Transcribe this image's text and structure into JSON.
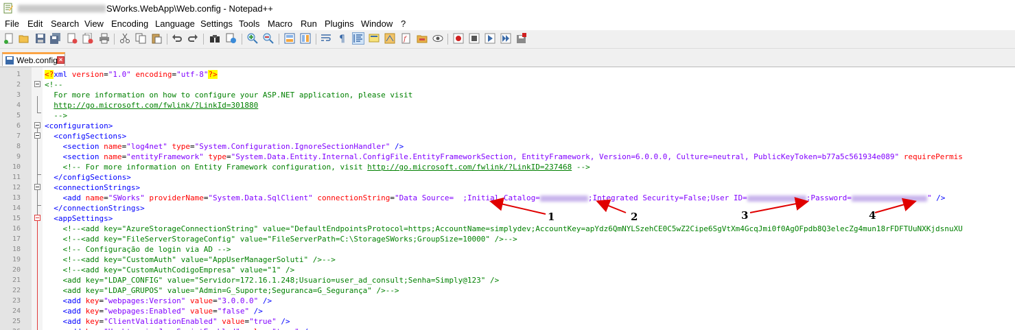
{
  "window": {
    "title_suffix": "SWorks.WebApp\\Web.config - Notepad++"
  },
  "menu": [
    "File",
    "Edit",
    "Search",
    "View",
    "Encoding",
    "Language",
    "Settings",
    "Tools",
    "Macro",
    "Run",
    "Plugins",
    "Window",
    "?"
  ],
  "toolbar_icons": [
    "new-file",
    "open-file",
    "save",
    "save-all",
    "close",
    "close-all",
    "print",
    "cut",
    "copy",
    "paste",
    "undo",
    "redo",
    "find",
    "replace",
    "zoom-in",
    "zoom-out",
    "sync-vertical",
    "sync-horizontal",
    "word-wrap",
    "show-all-chars",
    "indent-guide",
    "user-language",
    "doc-map",
    "function-list",
    "folder-as-workspace",
    "monitoring",
    "record-macro",
    "stop-macro",
    "play-macro",
    "run-macro-multiple",
    "save-macro"
  ],
  "tab": {
    "label": "Web.config"
  },
  "lines": [
    {
      "n": "1",
      "segs": [
        [
          "hl",
          "<?"
        ],
        [
          "k",
          "xml"
        ],
        [
          "a",
          " version"
        ],
        [
          "x",
          "="
        ],
        [
          "v",
          "\"1.0\""
        ],
        [
          "a",
          " encoding"
        ],
        [
          "x",
          "="
        ],
        [
          "v",
          "\"utf-8\""
        ],
        [
          "hl",
          "?>"
        ]
      ]
    },
    {
      "n": "2",
      "segs": [
        [
          "c",
          "<!--"
        ]
      ]
    },
    {
      "n": "3",
      "segs": [
        [
          "c",
          "  For more information on how to configure your ASP.NET application, please visit"
        ]
      ]
    },
    {
      "n": "4",
      "segs": [
        [
          "c",
          "  "
        ],
        [
          "u",
          "http://go.microsoft.com/fwlink/?LinkId=301880"
        ]
      ]
    },
    {
      "n": "5",
      "segs": [
        [
          "c",
          "  -->"
        ]
      ]
    },
    {
      "n": "6",
      "segs": [
        [
          "k",
          "<configuration>"
        ]
      ]
    },
    {
      "n": "7",
      "segs": [
        [
          "k",
          "  <configSections>"
        ]
      ]
    },
    {
      "n": "8",
      "segs": [
        [
          "k",
          "    <section"
        ],
        [
          "a",
          " name"
        ],
        [
          "x",
          "="
        ],
        [
          "v",
          "\"log4net\""
        ],
        [
          "a",
          " type"
        ],
        [
          "x",
          "="
        ],
        [
          "v",
          "\"System.Configuration.IgnoreSectionHandler\""
        ],
        [
          "k",
          " />"
        ]
      ]
    },
    {
      "n": "9",
      "segs": [
        [
          "k",
          "    <section"
        ],
        [
          "a",
          " name"
        ],
        [
          "x",
          "="
        ],
        [
          "v",
          "\"entityFramework\""
        ],
        [
          "a",
          " type"
        ],
        [
          "x",
          "="
        ],
        [
          "v",
          "\"System.Data.Entity.Internal.ConfigFile.EntityFrameworkSection, EntityFramework, Version=6.0.0.0, Culture=neutral, PublicKeyToken=b77a5c561934e089\""
        ],
        [
          "a",
          " requirePermis"
        ]
      ]
    },
    {
      "n": "10",
      "segs": [
        [
          "c",
          "    <!-- For more information on Entity Framework configuration, visit "
        ],
        [
          "u",
          "http://go.microsoft.com/fwlink/?LinkID=237468"
        ],
        [
          "c",
          " -->"
        ]
      ]
    },
    {
      "n": "11",
      "segs": [
        [
          "k",
          "  </configSections>"
        ]
      ]
    },
    {
      "n": "12",
      "segs": [
        [
          "k",
          "  <connectionStrings>"
        ]
      ]
    },
    {
      "n": "13",
      "segs": [
        [
          "k",
          "    <add"
        ],
        [
          "a",
          " name"
        ],
        [
          "x",
          "="
        ],
        [
          "v",
          "\"SWorks\""
        ],
        [
          "a",
          " providerName"
        ],
        [
          "x",
          "="
        ],
        [
          "v",
          "\"System.Data.SqlClient\""
        ],
        [
          "a",
          " connectionString"
        ],
        [
          "x",
          "="
        ],
        [
          "v",
          "\"Data Source=  ;Initial Catalog="
        ],
        [
          "blur",
          "70"
        ],
        [
          "v",
          ";Integrated Security=False;User ID="
        ],
        [
          "blur",
          "86"
        ],
        [
          "v",
          ";Password="
        ],
        [
          "blur",
          "110"
        ],
        [
          "v",
          "\""
        ],
        [
          "k",
          " />"
        ]
      ]
    },
    {
      "n": "14",
      "segs": [
        [
          "k",
          "  </connectionStrings>"
        ]
      ]
    },
    {
      "n": "15",
      "segs": [
        [
          "k",
          "  <appSettings>"
        ]
      ]
    },
    {
      "n": "16",
      "segs": [
        [
          "c",
          "    <!--<add key=\"AzureStorageConnectionString\" value=\"DefaultEndpointsProtocol=https;AccountName=simplydev;AccountKey=apYdz6QmNYLSzehCE0C5wZ2Cipe6SgVtXm4GcqJmi0f0AgOFpdb8Q3elecZg4mun18rFDFTUuNXKjdsnuXU"
        ]
      ]
    },
    {
      "n": "17",
      "segs": [
        [
          "c",
          "    <!--<add key=\"FileServerStorageConfig\" value=\"FileServerPath=C:\\StorageSWorks;GroupSize=10000\" />-->"
        ]
      ]
    },
    {
      "n": "18",
      "segs": [
        [
          "c",
          "    <!-- Configuração de login via AD -->"
        ]
      ]
    },
    {
      "n": "19",
      "segs": [
        [
          "c",
          "    <!--<add key=\"CustomAuth\" value=\"AppUserManagerSoluti\" />-->"
        ]
      ]
    },
    {
      "n": "20",
      "segs": [
        [
          "c",
          "    <!--<add key=\"CustomAuthCodigoEmpresa\" value=\"1\" />"
        ]
      ]
    },
    {
      "n": "21",
      "segs": [
        [
          "c",
          "    <add key=\"LDAP_CONFIG\" value=\"Servidor=172.16.1.248;Usuario=user_ad_consult;Senha=Simply@123\" />"
        ]
      ]
    },
    {
      "n": "22",
      "segs": [
        [
          "c",
          "    <add key=\"LDAP_GRUPOS\" value=\"Admin=G_Suporte;Seguranca=G_Segurança\" />-->"
        ]
      ]
    },
    {
      "n": "23",
      "segs": [
        [
          "k",
          "    <add"
        ],
        [
          "a",
          " key"
        ],
        [
          "x",
          "="
        ],
        [
          "v",
          "\"webpages:Version\""
        ],
        [
          "a",
          " value"
        ],
        [
          "x",
          "="
        ],
        [
          "v",
          "\"3.0.0.0\""
        ],
        [
          "k",
          " />"
        ]
      ]
    },
    {
      "n": "24",
      "segs": [
        [
          "k",
          "    <add"
        ],
        [
          "a",
          " key"
        ],
        [
          "x",
          "="
        ],
        [
          "v",
          "\"webpages:Enabled\""
        ],
        [
          "a",
          " value"
        ],
        [
          "x",
          "="
        ],
        [
          "v",
          "\"false\""
        ],
        [
          "k",
          " />"
        ]
      ]
    },
    {
      "n": "25",
      "segs": [
        [
          "k",
          "    <add"
        ],
        [
          "a",
          " key"
        ],
        [
          "x",
          "="
        ],
        [
          "v",
          "\"ClientValidationEnabled\""
        ],
        [
          "a",
          " value"
        ],
        [
          "x",
          "="
        ],
        [
          "v",
          "\"true\""
        ],
        [
          "k",
          " />"
        ]
      ]
    },
    {
      "n": "26",
      "segs": [
        [
          "k",
          "    <add"
        ],
        [
          "a",
          " key"
        ],
        [
          "x",
          "="
        ],
        [
          "v",
          "\"UnobtrusiveJavaScriptEnabled\""
        ],
        [
          "a",
          " value"
        ],
        [
          "x",
          "="
        ],
        [
          "v",
          "\"true\""
        ],
        [
          "k",
          " />"
        ]
      ]
    }
  ],
  "annotations": [
    "1",
    "2",
    "3",
    "4"
  ],
  "colors": {
    "tag": "#0000ff",
    "attribute": "#ff0000",
    "value": "#8000ff",
    "comment": "#008000",
    "arrow": "#e00000",
    "tab_accent": "#fba445"
  }
}
